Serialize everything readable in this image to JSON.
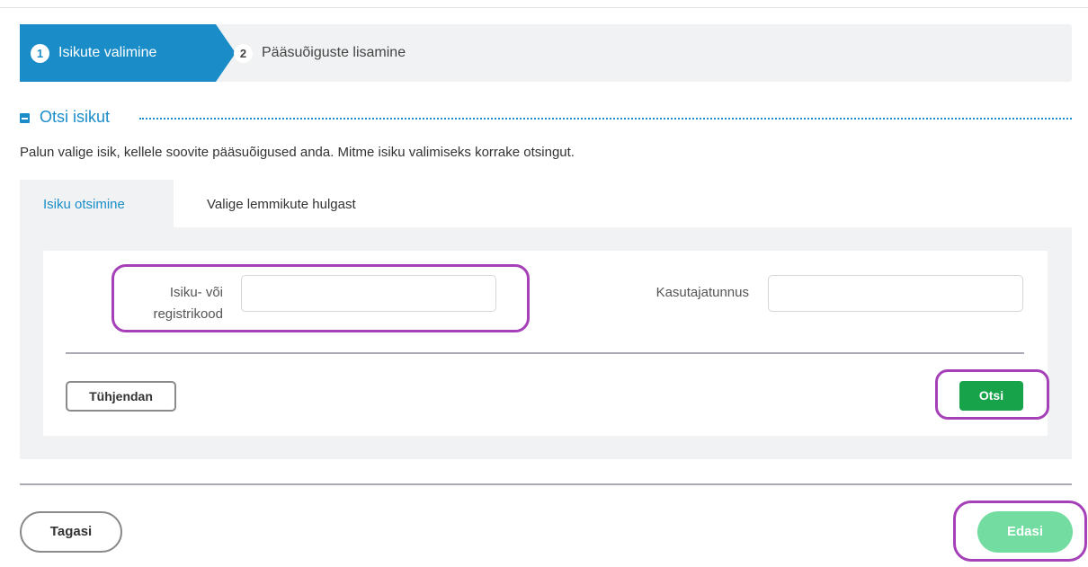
{
  "stepper": {
    "steps": [
      {
        "number": "1",
        "label": "Isikute valimine",
        "active": true
      },
      {
        "number": "2",
        "label": "Pääsuõiguste lisamine",
        "active": false
      }
    ]
  },
  "section": {
    "title": "Otsi isikut",
    "intro": "Palun valige isik, kellele soovite pääsuõigused anda. Mitme isiku valimiseks korrake otsingut."
  },
  "tabs": [
    {
      "label": "Isiku otsimine",
      "active": true
    },
    {
      "label": "Valige lemmikute hulgast",
      "active": false
    }
  ],
  "form": {
    "id_code_label_line1": "Isiku- või",
    "id_code_label_line2": "registrikood",
    "id_code_value": "",
    "username_label": "Kasutajatunnus",
    "username_value": ""
  },
  "buttons": {
    "clear": "Tühjendan",
    "search": "Otsi",
    "back": "Tagasi",
    "next": "Edasi"
  },
  "colors": {
    "accent": "#1a8dc8",
    "search_button": "#16a34a",
    "next_button_disabled": "#72dca1",
    "highlight": "#a640b8"
  }
}
